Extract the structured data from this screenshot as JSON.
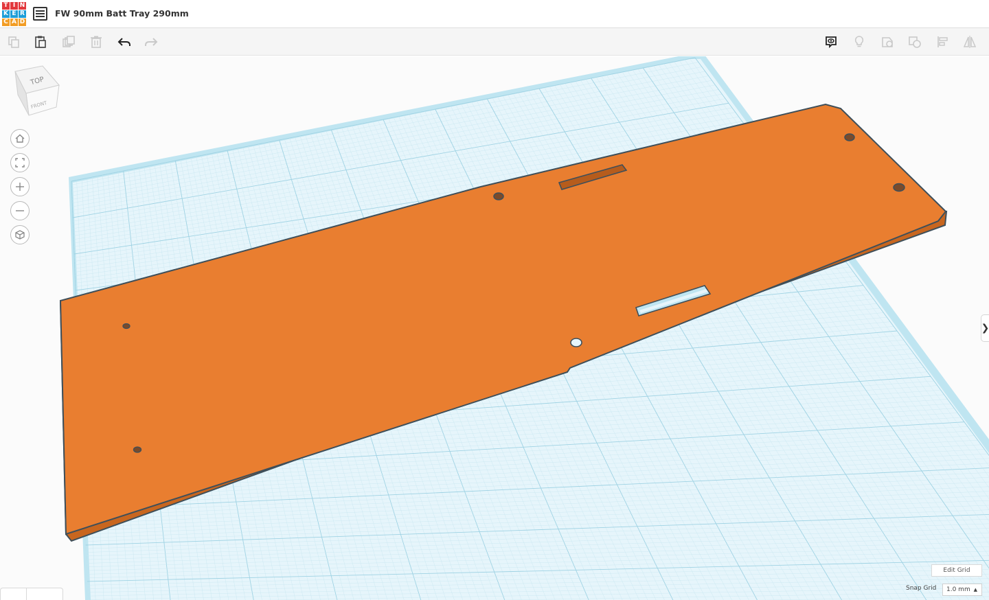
{
  "app": {
    "logo_letters": [
      "T",
      "I",
      "N",
      "K",
      "E",
      "R",
      "C",
      "A",
      "D"
    ],
    "logo_colors": [
      "#e2383c",
      "#e2383c",
      "#e2383c",
      "#1f9ed8",
      "#1f9ed8",
      "#1f9ed8",
      "#f29d25",
      "#f29d25",
      "#f29d25"
    ],
    "doc_title": "FW 90mm Batt Tray 290mm"
  },
  "toolbar": {
    "left_icons": [
      "copy-icon",
      "paste-icon",
      "duplicate-icon",
      "delete-icon",
      "undo-icon",
      "redo-icon"
    ],
    "right_icons": [
      "show-all-icon",
      "notes-icon",
      "shape-group-icon",
      "shape-ungroup-icon",
      "align-icon",
      "mirror-icon"
    ]
  },
  "viewcube": {
    "top_label": "TOP",
    "front_label": "FRONT"
  },
  "nav_controls": [
    "home-view-icon",
    "fit-view-icon",
    "zoom-in-icon",
    "zoom-out-icon",
    "ortho-view-icon"
  ],
  "grid": {
    "edit_label": "Edit Grid",
    "snap_label": "Snap Grid",
    "snap_value": "1.0 mm"
  },
  "colors": {
    "shape_fill": "#e97e30",
    "shape_edge": "#3e4f5a",
    "grid_fill": "#e6f5fb",
    "grid_minor": "#c7e6f0",
    "grid_major": "#9ed2e3"
  }
}
